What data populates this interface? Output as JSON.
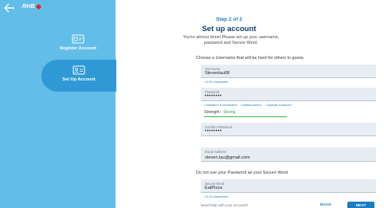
{
  "brand": {
    "logo_text": "RHB",
    "accent": "#e2231a",
    "sidebar_color": "#62bde8",
    "active_color": "#2f99d6"
  },
  "sidebar": {
    "steps": [
      {
        "label": "Register Account",
        "icon": "register-card-icon"
      },
      {
        "label": "Set Up Account",
        "icon": "setup-account-icon",
        "active": true
      }
    ]
  },
  "header": {
    "step": "Step 2 of 2",
    "title": "Set up account",
    "subtitle": "You're almost done! Please set up your username, password and Secure Word."
  },
  "username": {
    "note": "Choose a Username that will be hard for others to guess.",
    "label": "Username",
    "value": "Stevenlau08",
    "hint": "• 6-20 characters"
  },
  "password": {
    "label": "Password",
    "value": "••••••••",
    "hints": [
      "• Minimum 8 characters",
      "• Alphanumeric",
      "• Special character"
    ],
    "strength_label": "Strength:",
    "strength_value": "Strong",
    "strength_level": 1.0
  },
  "confirm_password": {
    "label": "Confirm Password",
    "value": "••••••••"
  },
  "email": {
    "label": "Email Address",
    "value": "steven.lau@gmail.com"
  },
  "secure_word": {
    "note": "Do not use your Password as your Secure Word.",
    "label": "Secure Word",
    "value": "EatPizza",
    "hint": "• 6-10 characters"
  },
  "footer": {
    "help": "Need help with your account?",
    "back_label": "BACK",
    "next_label": "NEXT"
  }
}
